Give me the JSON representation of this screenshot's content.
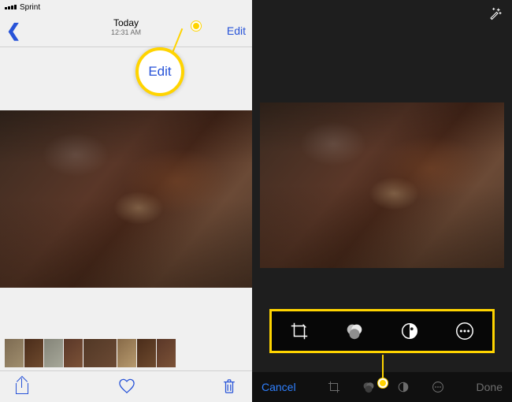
{
  "left": {
    "status": {
      "carrier": "Sprint"
    },
    "nav": {
      "title": "Today",
      "subtitle": "12:31 AM",
      "edit_label": "Edit"
    },
    "callout_label": "Edit",
    "toolbar": {
      "share_name": "share",
      "like_name": "favorite",
      "trash_name": "delete"
    }
  },
  "right": {
    "tools": {
      "crop_name": "crop",
      "filters_name": "filters",
      "adjust_name": "adjust",
      "more_name": "more"
    },
    "editbar": {
      "cancel_label": "Cancel",
      "done_label": "Done"
    }
  }
}
